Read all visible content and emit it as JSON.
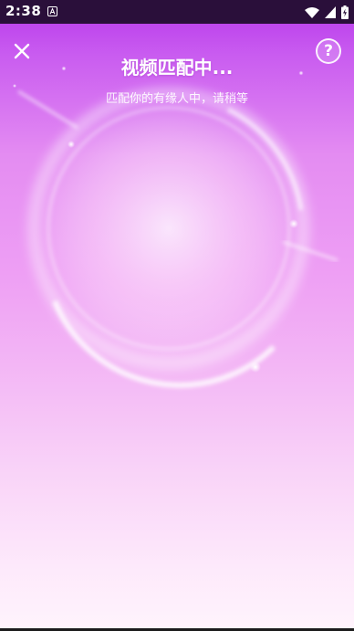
{
  "status_bar": {
    "time": "2:38",
    "icons": [
      "notification-a-icon",
      "wifi-icon",
      "signal-icon",
      "battery-charging-icon"
    ]
  },
  "header": {
    "title": "视频匹配中...",
    "subtitle": "匹配你的有缘人中，请稍等",
    "close_icon": "close-icon",
    "help_label": "?"
  },
  "colors": {
    "status_bar_bg": "#2a0f3a",
    "gradient_top": "#b636ea",
    "gradient_mid": "#ee9ff4",
    "gradient_bottom": "#fff4fc",
    "text": "#ffffff"
  }
}
